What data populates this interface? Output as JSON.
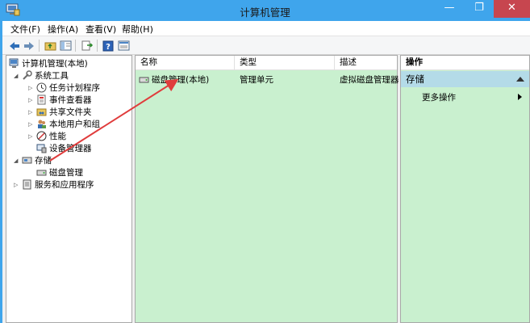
{
  "window": {
    "title": "计算机管理",
    "minimize_glyph": "—",
    "maximize_glyph": "❐",
    "close_glyph": "✕"
  },
  "menu": [
    {
      "label": "文件(F)"
    },
    {
      "label": "操作(A)"
    },
    {
      "label": "查看(V)"
    },
    {
      "label": "帮助(H)"
    }
  ],
  "toolbar": [
    "back-icon",
    "forward-icon",
    "up-folder-icon",
    "show-tree-icon",
    "export-icon",
    "help-icon",
    "properties-icon"
  ],
  "tree": {
    "root": "计算机管理(本地)",
    "system_tools": "系统工具",
    "task_scheduler": "任务计划程序",
    "event_viewer": "事件查看器",
    "shared_folders": "共享文件夹",
    "local_users": "本地用户和组",
    "performance": "性能",
    "device_manager": "设备管理器",
    "storage": "存储",
    "disk_management": "磁盘管理",
    "services_apps": "服务和应用程序"
  },
  "list": {
    "columns": [
      "名称",
      "类型",
      "描述"
    ],
    "rows": [
      {
        "name": "磁盘管理(本地)",
        "type": "管理单元",
        "desc": "虚拟磁盘管理器"
      }
    ]
  },
  "actions": {
    "header": "操作",
    "section": "存储",
    "more": "更多操作"
  },
  "colors": {
    "titlebar": "#3fa5ec",
    "pane_green": "#c9f0cf",
    "section_blue": "#b4dbe8",
    "close_red": "#c7464f",
    "arrow_red": "#e03c3c"
  }
}
